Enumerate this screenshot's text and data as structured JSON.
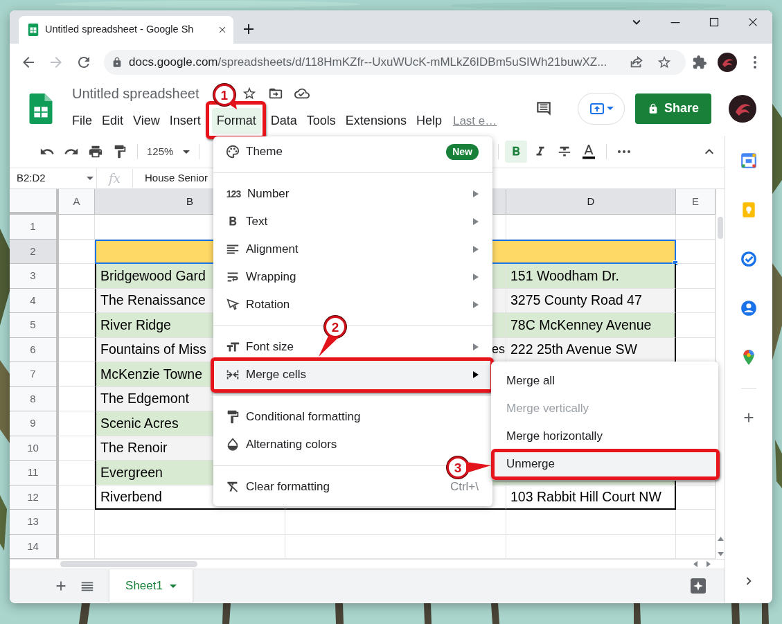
{
  "browser": {
    "tab_title": "Untitled spreadsheet - Google Sh",
    "url_host": "docs.google.com",
    "url_path": "/spreadsheets/d/118HmKZfr--UxuWUcK-mMLkZ6IDBm5uSIWh21buwXZ..."
  },
  "document": {
    "title": "Untitled spreadsheet",
    "share_label": "Share",
    "last_edit": "Last e…"
  },
  "menu_bar": [
    {
      "label": "File",
      "selected": false
    },
    {
      "label": "Edit",
      "selected": false
    },
    {
      "label": "View",
      "selected": false
    },
    {
      "label": "Insert",
      "selected": false
    },
    {
      "label": "Format",
      "selected": true,
      "callout": "1"
    },
    {
      "label": "Data",
      "selected": false
    },
    {
      "label": "Tools",
      "selected": false
    },
    {
      "label": "Extensions",
      "selected": false
    },
    {
      "label": "Help",
      "selected": false
    }
  ],
  "toolbar": {
    "zoom": "125%",
    "bold": true,
    "italic": false,
    "strikethrough": false,
    "text_color": {
      "color": "#000000"
    }
  },
  "formula_bar": {
    "cell_ref": "B2:D2",
    "function_symbol": "fx",
    "content": "House Senior"
  },
  "columns": [
    {
      "label": "A",
      "selected": false
    },
    {
      "label": "B",
      "selected": true
    },
    {
      "selected": true
    },
    {
      "label": "D",
      "selected": true
    },
    {
      "label": "E",
      "selected": false
    }
  ],
  "rows": [
    {
      "number": "1",
      "selected": false,
      "bordered": false
    },
    {
      "number": "2",
      "selected": true,
      "bordered": true,
      "merged": true,
      "color": "#ffd966"
    },
    {
      "number": "3",
      "selected": false,
      "bordered": true,
      "color": "#d9ead3",
      "column_b": "Bridgewood Gard",
      "column_d": "151 Woodham Dr."
    },
    {
      "number": "4",
      "selected": false,
      "bordered": true,
      "color": "#f3f3f3",
      "column_b": "The Renaissance",
      "column_d": "3275 County Road 47"
    },
    {
      "number": "5",
      "selected": false,
      "bordered": true,
      "color": "#d9ead3",
      "column_b": "River Ridge",
      "column_d": "78C McKenney Avenue"
    },
    {
      "number": "6",
      "selected": false,
      "bordered": true,
      "color": "#f3f3f3",
      "column_b": "Fountains of Miss",
      "column_c": "es",
      "column_d": "222 25th Avenue SW"
    },
    {
      "number": "7",
      "selected": false,
      "bordered": true,
      "color": "#d9ead3",
      "column_b": "McKenzie Towne"
    },
    {
      "number": "8",
      "selected": false,
      "bordered": true,
      "color": "#f3f3f3",
      "column_b": "The Edgemont"
    },
    {
      "number": "9",
      "selected": false,
      "bordered": true,
      "color": "#d9ead3",
      "column_b": "Scenic Acres"
    },
    {
      "number": "10",
      "selected": false,
      "bordered": true,
      "color": "#f3f3f3",
      "column_b": "The Renoir"
    },
    {
      "number": "11",
      "selected": false,
      "bordered": true,
      "color": "#d9ead3",
      "column_b": "Evergreen"
    },
    {
      "number": "12",
      "selected": false,
      "bordered": true,
      "color": "#ffffff",
      "column_b": "Riverbend",
      "column_d": "103 Rabbit Hill Court NW"
    },
    {
      "number": "13",
      "selected": false,
      "bordered": false
    },
    {
      "number": "14",
      "selected": false,
      "bordered": false
    }
  ],
  "format_menu": [
    {
      "kind": "theme",
      "label": "Theme",
      "badge": "New",
      "selected": false
    },
    {
      "kind": "separator"
    },
    {
      "kind": "number",
      "glyph": "123",
      "label": "Number",
      "submenu": true,
      "selected": false
    },
    {
      "kind": "text",
      "label": "Text",
      "submenu": true,
      "selected": false
    },
    {
      "kind": "alignment",
      "label": "Alignment",
      "submenu": true,
      "selected": false
    },
    {
      "kind": "wrapping",
      "label": "Wrapping",
      "submenu": true,
      "selected": false
    },
    {
      "kind": "rotation",
      "label": "Rotation",
      "submenu": true,
      "selected": false
    },
    {
      "kind": "separator"
    },
    {
      "kind": "font-size",
      "label": "Font size",
      "submenu": true,
      "selected": false
    },
    {
      "kind": "merge",
      "label": "Merge cells",
      "submenu": true,
      "selected": true,
      "callout": "2"
    },
    {
      "kind": "separator"
    },
    {
      "kind": "conditional",
      "label": "Conditional formatting",
      "selected": false
    },
    {
      "kind": "alternating",
      "label": "Alternating colors",
      "selected": false
    },
    {
      "kind": "separator"
    },
    {
      "kind": "clear",
      "label": "Clear formatting",
      "shortcut": "Ctrl+\\",
      "selected": false
    }
  ],
  "merge_submenu": [
    {
      "label": "Merge all",
      "disabled": false,
      "selected": false
    },
    {
      "label": "Merge vertically",
      "disabled": true,
      "selected": false
    },
    {
      "label": "Merge horizontally",
      "disabled": false,
      "selected": false
    },
    {
      "label": "Unmerge",
      "disabled": false,
      "selected": true,
      "callout": "3"
    }
  ],
  "sheet_tabs": [
    {
      "label": "Sheet1",
      "selected": true
    }
  ]
}
